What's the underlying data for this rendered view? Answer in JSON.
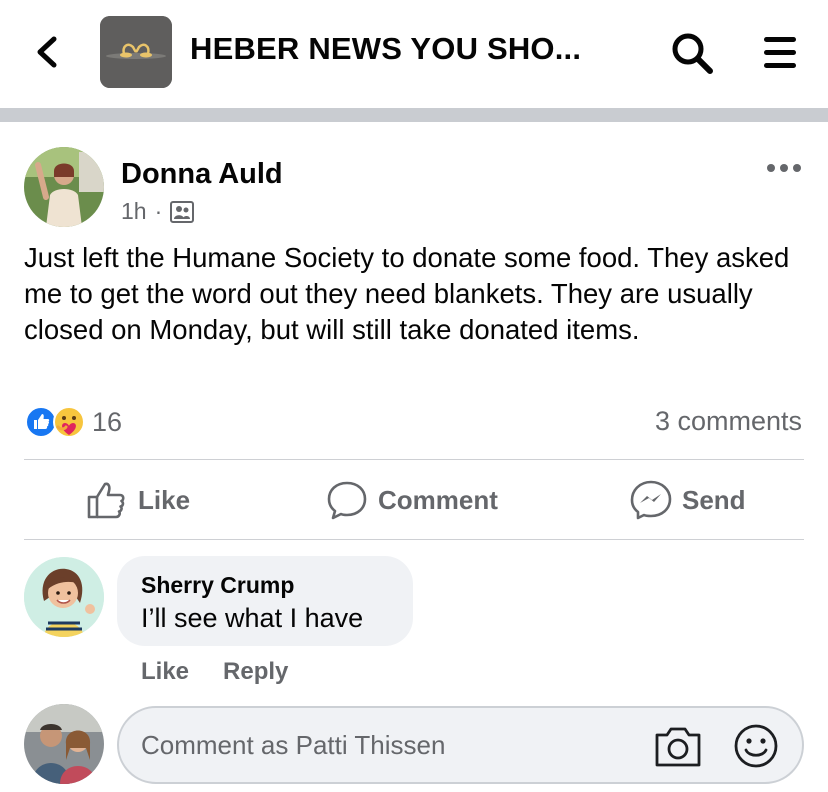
{
  "header": {
    "title": "HEBER NEWS YOU SHO...",
    "back_icon": "chevron-left-icon",
    "search_icon": "search-icon",
    "menu_icon": "menu-icon"
  },
  "post": {
    "author": "Donna Auld",
    "time": "1h",
    "separator": "·",
    "audience_icon": "group-audience-icon",
    "text": "Just left the Humane Society to donate some food. They asked me to get the word out they need blankets. They are usually closed on Monday, but will still take donated items.",
    "reaction_count": "16",
    "comments_count": "3 comments",
    "reaction_icons": [
      "like-reaction-icon",
      "care-reaction-icon"
    ]
  },
  "actions": {
    "like": "Like",
    "comment": "Comment",
    "send": "Send"
  },
  "comment": {
    "author": "Sherry Crump",
    "text": "I’ll see what I have",
    "like": "Like",
    "reply": "Reply"
  },
  "composer": {
    "placeholder": "Comment as Patti Thissen"
  },
  "colors": {
    "secondary_text": "#65676b",
    "bubble_bg": "#f0f2f5",
    "like_blue": "#1877f2",
    "divider": "#c9ccd1"
  }
}
